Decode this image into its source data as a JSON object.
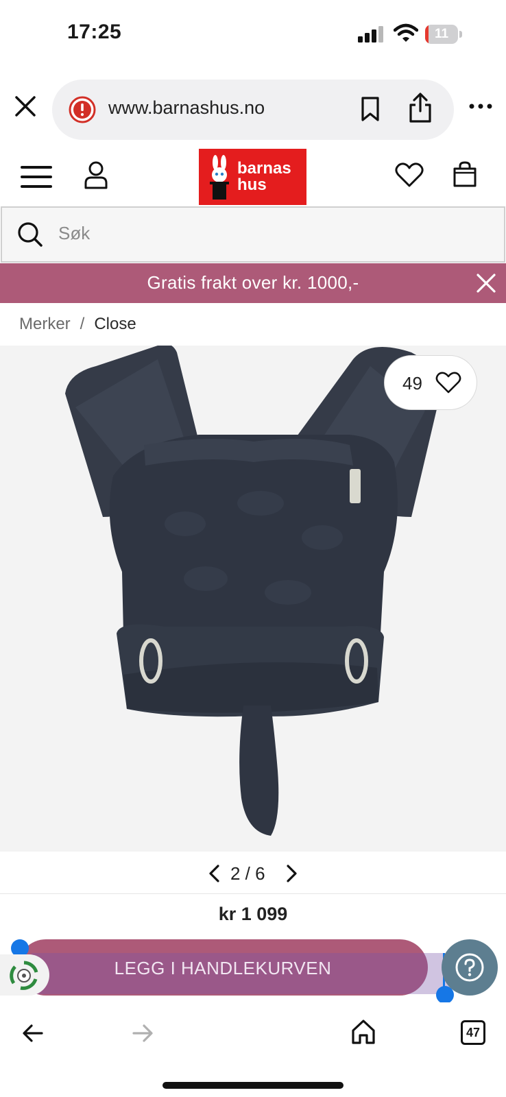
{
  "status_bar": {
    "time": "17:25",
    "battery_level": "11",
    "battery_fraction": 0.11,
    "icons": [
      "signal-icon",
      "wifi-icon",
      "battery-icon"
    ]
  },
  "browser": {
    "url": "www.barnashus.no",
    "icons": [
      "close-icon",
      "security-warning-icon",
      "bookmark-icon",
      "share-icon",
      "more-icon"
    ]
  },
  "header": {
    "logo_line1": "barnas",
    "logo_line2": "hus",
    "brand_color": "#e41d1e",
    "icons": [
      "menu-icon",
      "account-icon",
      "wishlist-icon",
      "bag-icon"
    ]
  },
  "search": {
    "placeholder": "Søk"
  },
  "promo": {
    "text": "Gratis frakt over kr. 1000,-",
    "color": "#ad5a78"
  },
  "breadcrumb": {
    "items": [
      "Merker",
      "Close"
    ],
    "separator": "/"
  },
  "product": {
    "like_count": "49",
    "image_pager": "2 / 6",
    "price": "kr 1 099",
    "add_to_cart_label": "LEGG I HANDLEKURVEN"
  },
  "toolbar": {
    "tabs_count": "47",
    "icons": [
      "back-arrow-icon",
      "forward-arrow-icon",
      "home-icon",
      "tabs-icon"
    ]
  }
}
